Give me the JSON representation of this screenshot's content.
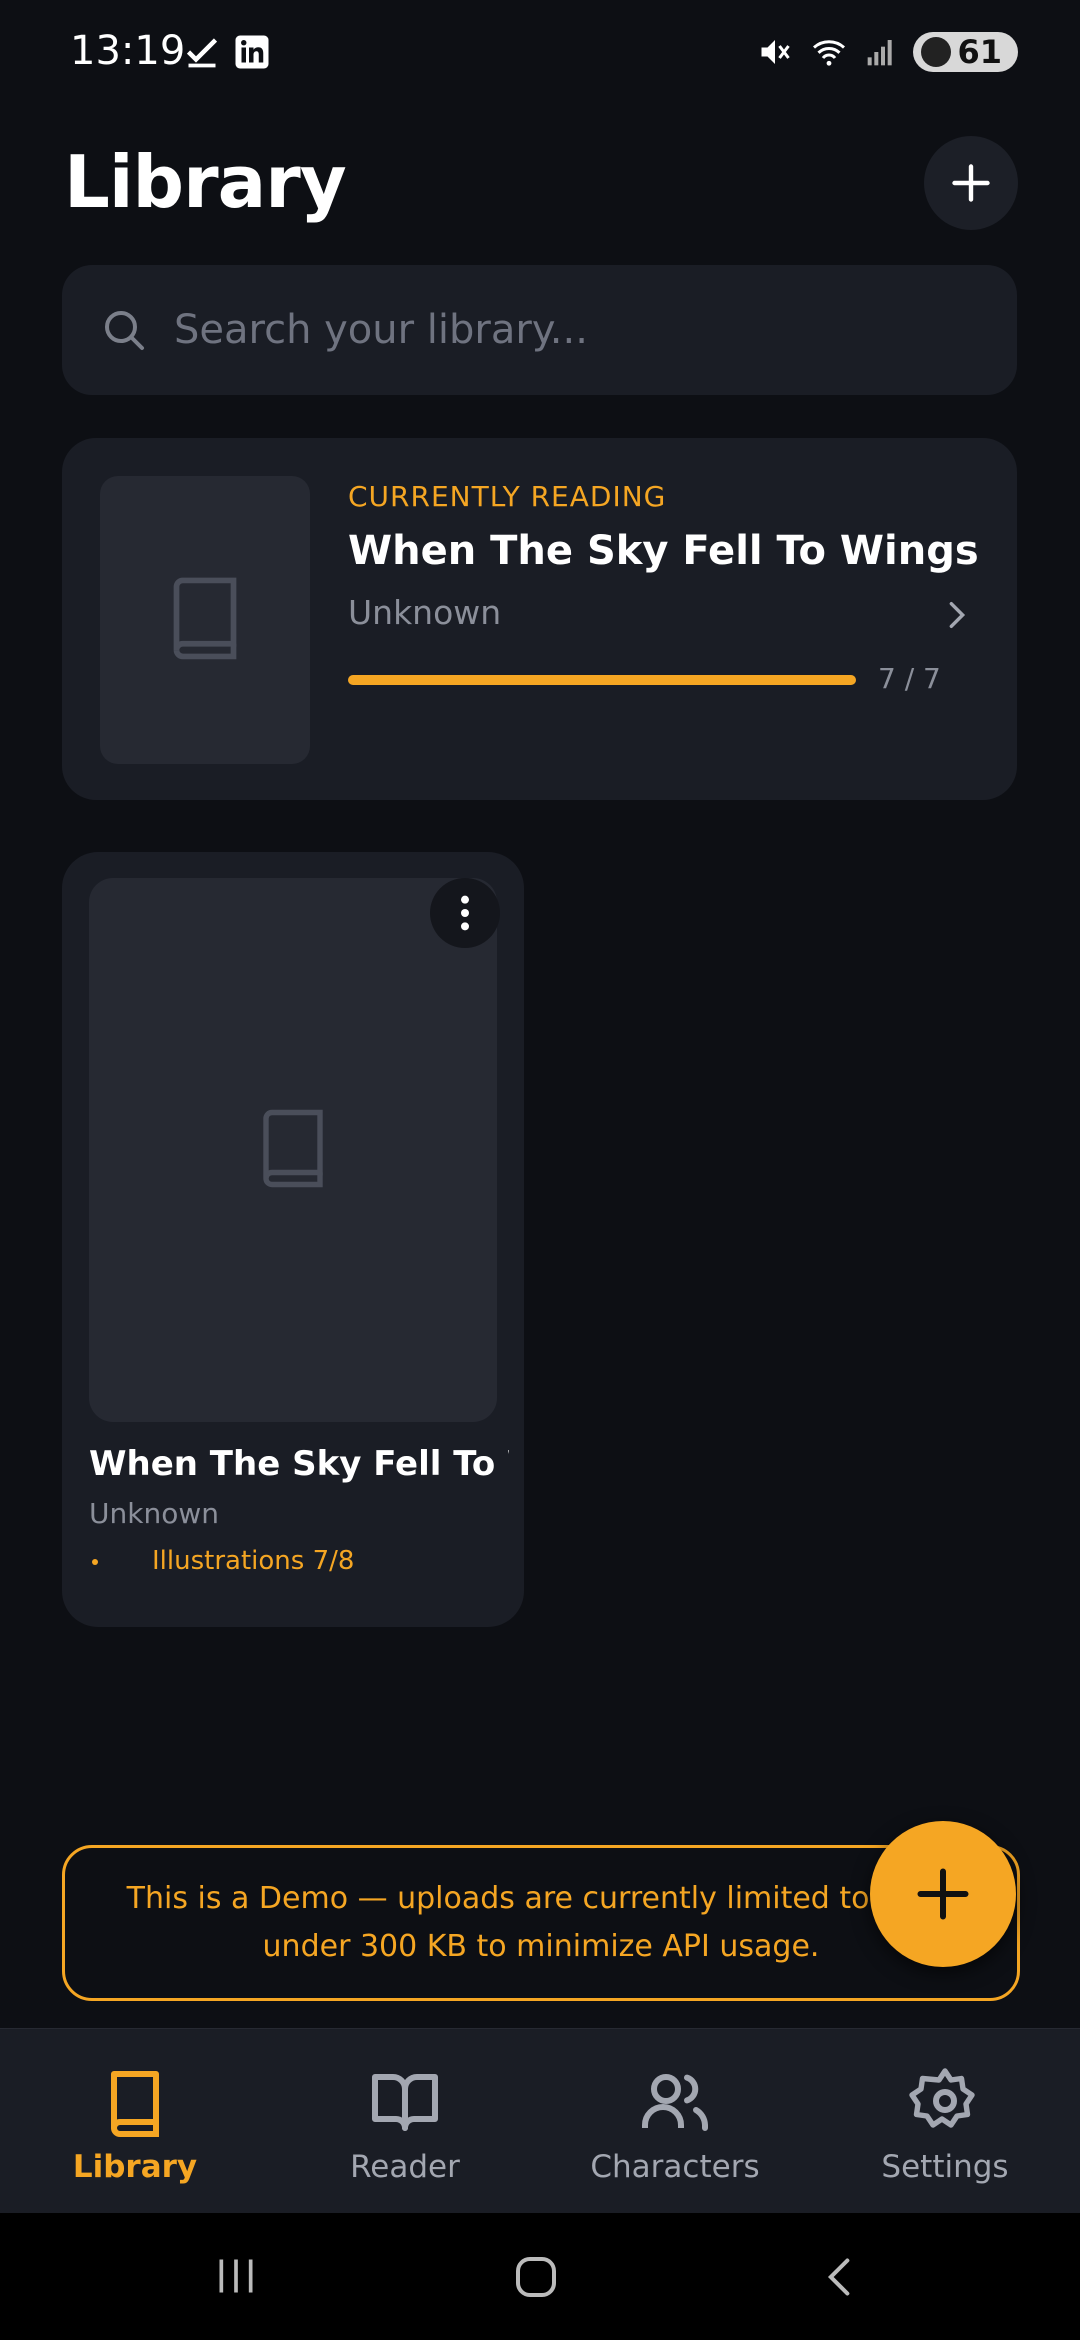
{
  "status_bar": {
    "time": "13:19",
    "battery": "61"
  },
  "header": {
    "title": "Library"
  },
  "search": {
    "placeholder": "Search your library..."
  },
  "currently_reading": {
    "kicker": "CURRENTLY READING",
    "title": "When The Sky Fell To Wings",
    "author": "Unknown",
    "progress_text": "7 / 7",
    "progress_fraction": 1.0
  },
  "books": [
    {
      "title": "When The Sky Fell To Wi...",
      "author": "Unknown",
      "illustrations": "Illustrations 7/8"
    }
  ],
  "demo_banner": {
    "text": "This is a Demo — uploads are currently limited to 2 b... under 300 KB to minimize API usage."
  },
  "bottom_nav": {
    "items": [
      {
        "label": "Library",
        "active": true
      },
      {
        "label": "Reader",
        "active": false
      },
      {
        "label": "Characters",
        "active": false
      },
      {
        "label": "Settings",
        "active": false
      }
    ]
  },
  "colors": {
    "accent": "#f5a623",
    "background": "#0d0f14",
    "surface": "#1a1d25"
  }
}
